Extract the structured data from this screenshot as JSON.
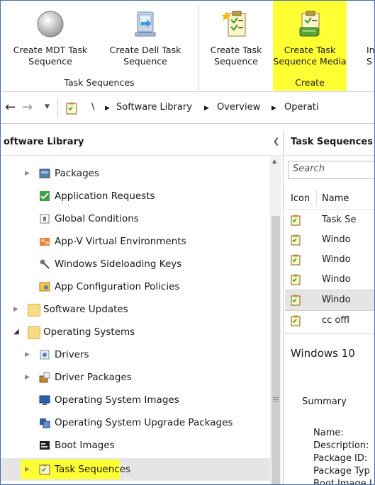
{
  "ribbon": {
    "buttons": [
      {
        "label": "Create MDT Task\nSequence"
      },
      {
        "label": "Create Dell Task\nSequence"
      },
      {
        "label": "Create Task\nSequence"
      },
      {
        "label": "Create Task\nSequence Media"
      },
      {
        "label": "In\nS"
      }
    ],
    "groups": [
      "Task Sequences",
      "Create"
    ]
  },
  "address": {
    "root_sep": "\\",
    "crumbs": [
      "Software Library",
      "Overview",
      "Operati"
    ]
  },
  "left": {
    "title": "oftware Library",
    "items": [
      "Packages",
      "Application Requests",
      "Global Conditions",
      "App-V Virtual Environments",
      "Windows Sideloading Keys",
      "App Configuration Policies",
      "Software Updates",
      "Operating Systems",
      "Drivers",
      "Driver Packages",
      "Operating System Images",
      "Operating System Upgrade Packages",
      "Boot Images",
      "Task Sequences"
    ]
  },
  "right": {
    "title": "Task Sequences",
    "search_placeholder": "Search",
    "columns": [
      "Icon",
      "Name"
    ],
    "rows": [
      "Task Se",
      "Windo",
      "Windo",
      "Windo",
      "Windo",
      "cc offl"
    ],
    "detail_title": "Windows 10",
    "summary": "Summary",
    "props": [
      "Name:",
      "Description:",
      "Package ID:",
      "Package Typ",
      "Boot Image I"
    ]
  },
  "colors": {
    "highlight": "#ffff33",
    "selection": "#e5e5e5"
  }
}
